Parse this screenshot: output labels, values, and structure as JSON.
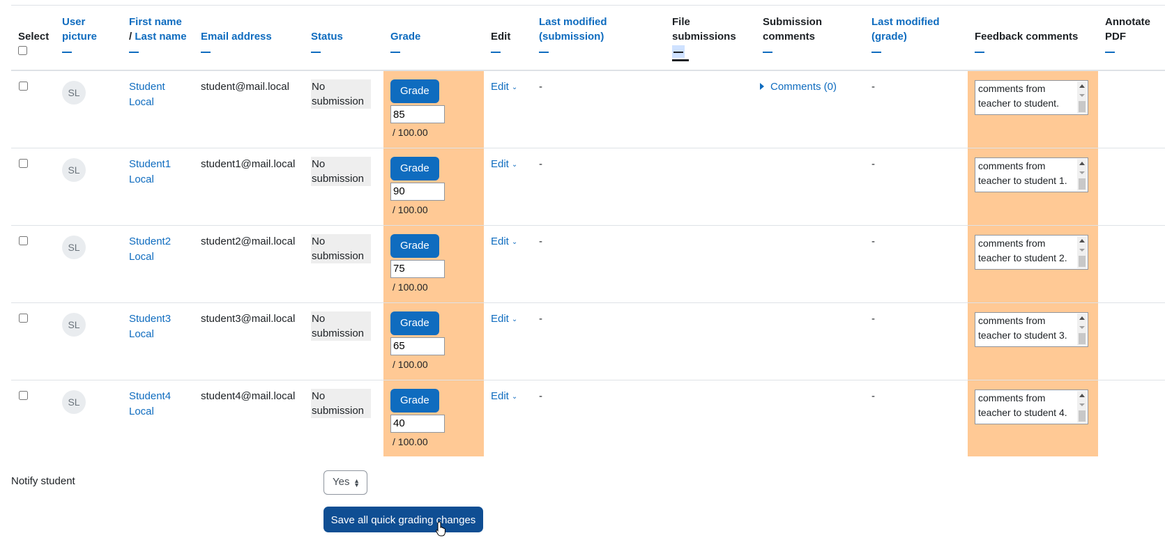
{
  "header": {
    "select": "Select",
    "user_picture": "User picture",
    "first_name": "First name",
    "last_name_sep": "/",
    "last_name": "Last name",
    "email": "Email address",
    "status": "Status",
    "grade": "Grade",
    "edit": "Edit",
    "last_modified_submission_1": "Last modified",
    "last_modified_submission_2": "(submission)",
    "file_submissions_1": "File",
    "file_submissions_2": "submissions",
    "submission_comments_1": "Submission",
    "submission_comments_2": "comments",
    "last_modified_grade_1": "Last modified",
    "last_modified_grade_2": "(grade)",
    "feedback_comments": "Feedback comments",
    "annotate_pdf_1": "Annotate",
    "annotate_pdf_2": "PDF"
  },
  "rows": [
    {
      "initials": "SL",
      "first": "Student",
      "last": "Local",
      "email": "student@mail.local",
      "status_1": "No",
      "status_2": "submission",
      "grade_button": "Grade",
      "grade_value": "85",
      "out_of": "/ 100.00",
      "edit": "Edit",
      "last_mod_sub": "-",
      "comments": "Comments (0)",
      "last_mod_grade": "-",
      "feedback_1": "comments from",
      "feedback_2": "teacher to student."
    },
    {
      "initials": "SL",
      "first": "Student1",
      "last": "Local",
      "email": "student1@mail.local",
      "status_1": "No",
      "status_2": "submission",
      "grade_button": "Grade",
      "grade_value": "90",
      "out_of": "/ 100.00",
      "edit": "Edit",
      "last_mod_sub": "-",
      "comments": "",
      "last_mod_grade": "-",
      "feedback_1": "comments from",
      "feedback_2": "teacher to student 1."
    },
    {
      "initials": "SL",
      "first": "Student2",
      "last": "Local",
      "email": "student2@mail.local",
      "status_1": "No",
      "status_2": "submission",
      "grade_button": "Grade",
      "grade_value": "75",
      "out_of": "/ 100.00",
      "edit": "Edit",
      "last_mod_sub": "-",
      "comments": "",
      "last_mod_grade": "-",
      "feedback_1": "comments from",
      "feedback_2": "teacher to student 2."
    },
    {
      "initials": "SL",
      "first": "Student3",
      "last": "Local",
      "email": "student3@mail.local",
      "status_1": "No",
      "status_2": "submission",
      "grade_button": "Grade",
      "grade_value": "65",
      "out_of": "/ 100.00",
      "edit": "Edit",
      "last_mod_sub": "-",
      "comments": "",
      "last_mod_grade": "-",
      "feedback_1": "comments from",
      "feedback_2": "teacher to student 3."
    },
    {
      "initials": "SL",
      "first": "Student4",
      "last": "Local",
      "email": "student4@mail.local",
      "status_1": "No",
      "status_2": "submission",
      "grade_button": "Grade",
      "grade_value": "40",
      "out_of": "/ 100.00",
      "edit": "Edit",
      "last_mod_sub": "-",
      "comments": "",
      "last_mod_grade": "-",
      "feedback_1": "comments from",
      "feedback_2": "teacher to student 4."
    }
  ],
  "footer": {
    "notify_label": "Notify student",
    "notify_value": "Yes",
    "save_button": "Save all quick grading changes"
  },
  "colors": {
    "link": "#0f6cbf",
    "highlight_column": "#ffc995",
    "primary_button": "#0f6cbf",
    "save_button": "#0f4e93"
  }
}
